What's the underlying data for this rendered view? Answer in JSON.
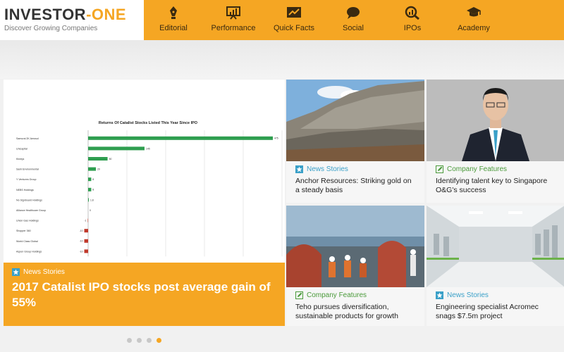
{
  "logo": {
    "title_main": "INVESTOR",
    "title_accent": "-ONE",
    "tagline": "Discover Growing Companies"
  },
  "nav": [
    {
      "label": "Editorial",
      "icon": "pen-nib-icon"
    },
    {
      "label": "Performance",
      "icon": "presentation-chart-icon"
    },
    {
      "label": "Quick Facts",
      "icon": "trend-chart-icon"
    },
    {
      "label": "Social",
      "icon": "speech-bubble-icon"
    },
    {
      "label": "IPOs",
      "icon": "magnifier-chart-icon"
    },
    {
      "label": "Academy",
      "icon": "graduation-cap-icon"
    }
  ],
  "hero": {
    "category": "News Stories",
    "title": "2017 Catalist IPO stocks post average gain of 55%"
  },
  "chart_data": {
    "type": "bar",
    "title": "Returns Of Catalist Stocks Listed This Year Since IPO",
    "categories": [
      "Samurai 2K Aerosol",
      "Unicapital",
      "Kinerja",
      "Sanli Environmental",
      "Y Ventures Group",
      "NEBS Holdings",
      "No Signboard Holdings",
      "Alliance Healthcare Group",
      "Union Gas Holdings",
      "Shopper 360",
      "World Class Global",
      "Aspen Group Holdings"
    ],
    "values": [
      475,
      145,
      50,
      20,
      8,
      8,
      1.8,
      0,
      -1,
      -10,
      -10,
      -10
    ],
    "value_labels": [
      "475",
      "145",
      "50",
      "20",
      "8",
      "8",
      "1.8",
      "0",
      "-1",
      "-10",
      "-10",
      "-10"
    ],
    "colors": {
      "positive": "#2e9e4f",
      "negative": "#c0392b"
    },
    "grid": true
  },
  "cards": [
    {
      "category": "News Stories",
      "kind": "news",
      "title": "Anchor Resources: Striking gold on a steady basis"
    },
    {
      "category": "Company Features",
      "kind": "feature",
      "title": "Identifying talent key to Singapore O&G's success"
    },
    {
      "category": "Company Features",
      "kind": "feature",
      "title": "Teho pursues diversification, sustainable products for growth"
    },
    {
      "category": "News Stories",
      "kind": "news",
      "title": "Engineering specialist Acromec snags $7.5m project"
    }
  ],
  "colors": {
    "accent": "#f5a623",
    "news": "#3aa0c8",
    "feature": "#4a9a3a"
  }
}
